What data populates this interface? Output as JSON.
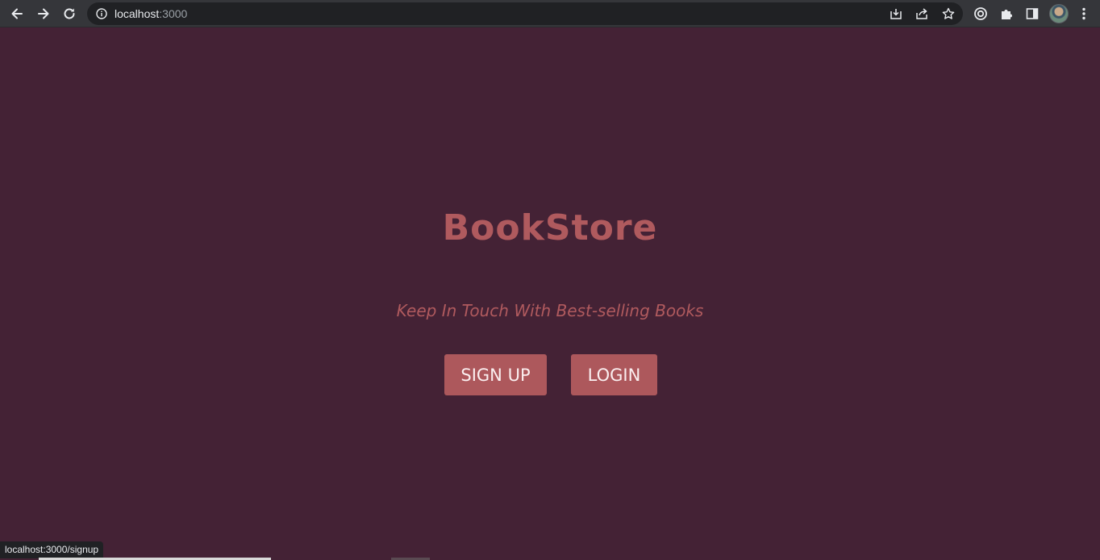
{
  "browser": {
    "url_host": "localhost",
    "url_port": ":3000",
    "status_url": "localhost:3000/signup",
    "icons": {
      "back": "back-arrow-icon",
      "forward": "forward-arrow-icon",
      "reload": "reload-icon",
      "site_info": "info-icon",
      "install": "install-icon",
      "share": "share-icon",
      "bookmark": "star-icon",
      "lens": "lens-icon",
      "extensions": "puzzle-icon",
      "side_panel": "side-panel-icon",
      "profile": "avatar",
      "menu": "kebab-menu-icon"
    }
  },
  "page": {
    "title": "BookStore",
    "subtitle": "Keep In Touch With Best-selling Books",
    "signup_label": "SIGN UP",
    "login_label": "LOGIN"
  },
  "colors": {
    "background": "#442235",
    "accent": "#b05a5e",
    "button_bg": "#ad585c",
    "button_text": "#fbeff0"
  }
}
